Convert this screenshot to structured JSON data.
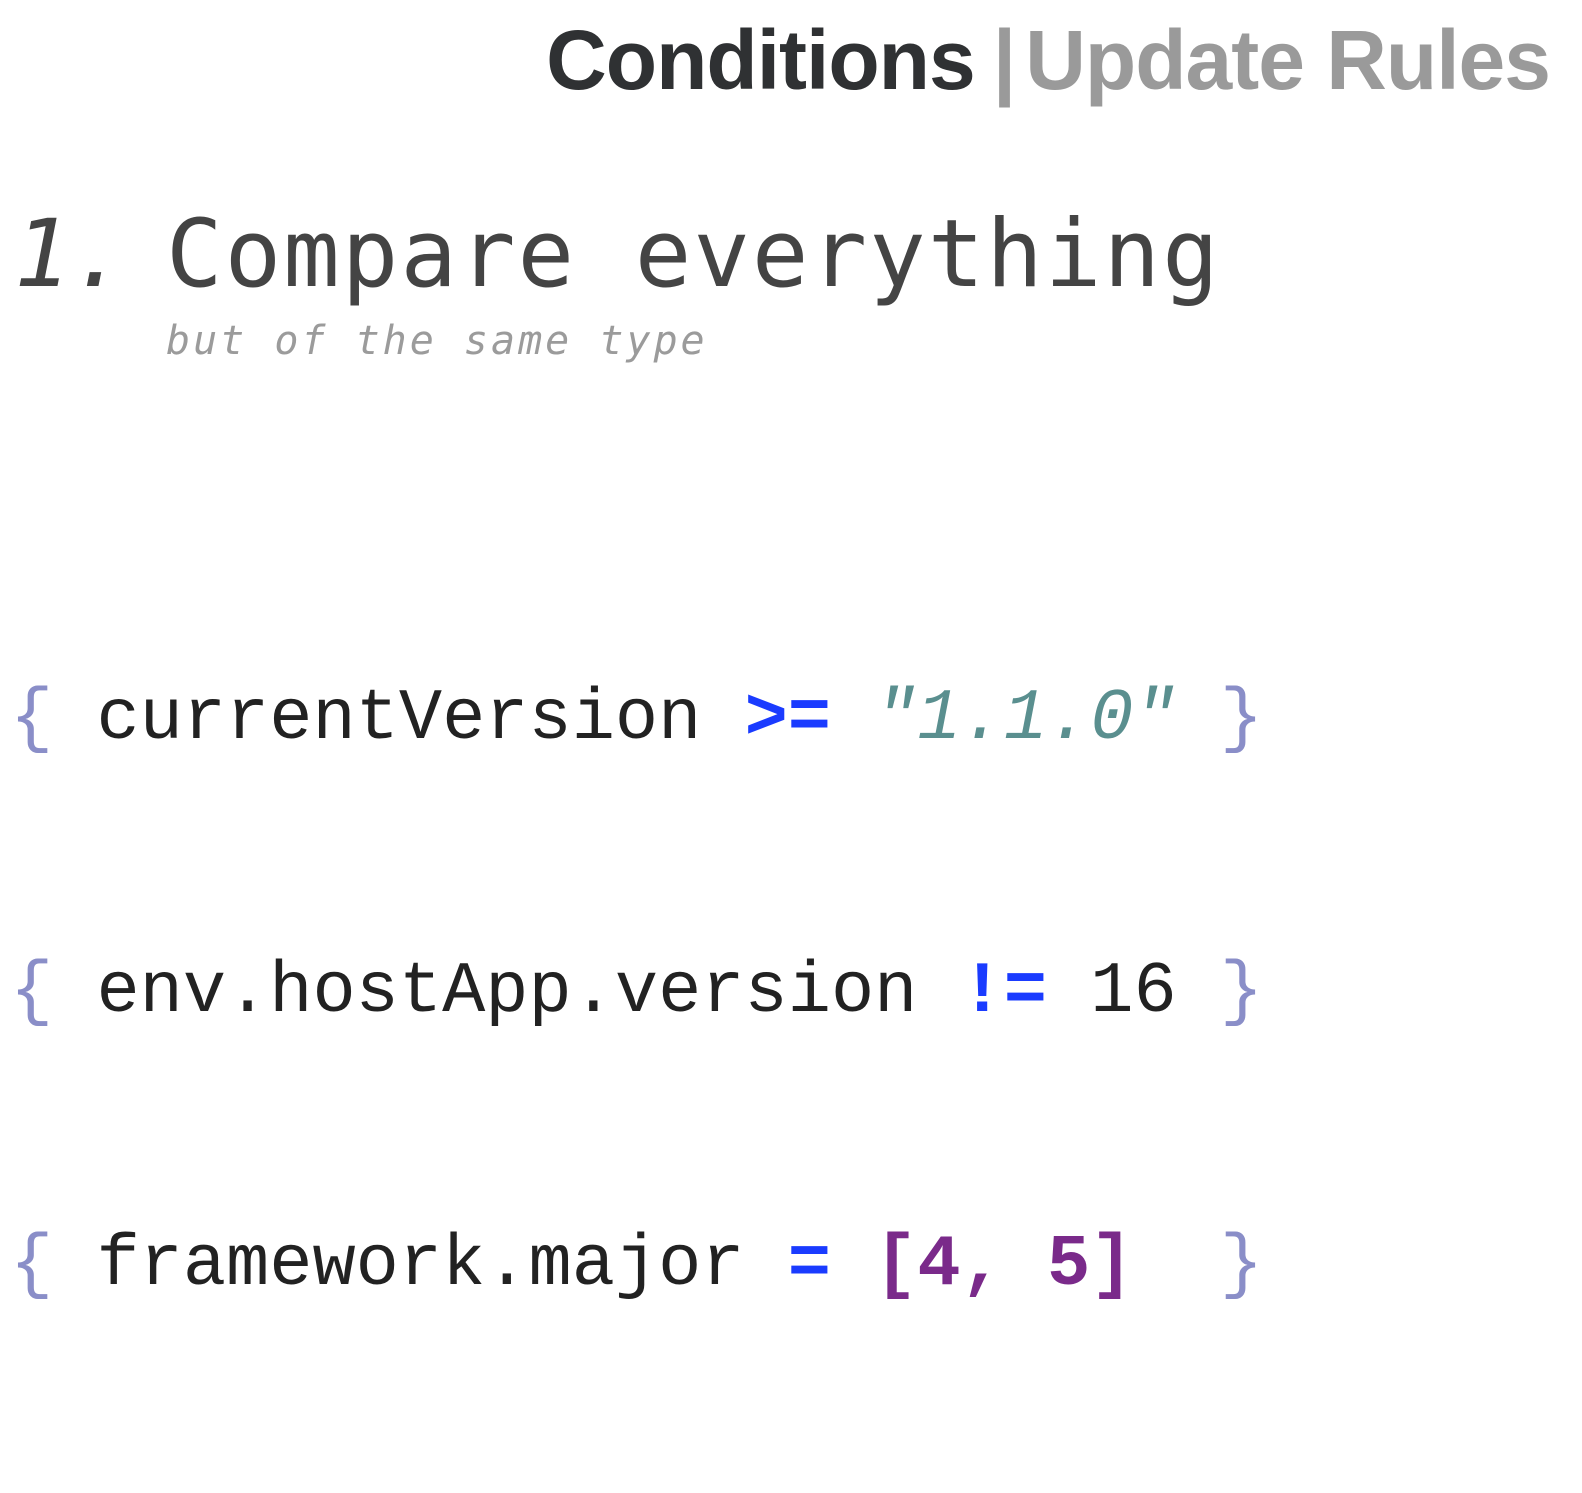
{
  "header": {
    "active_label": "Conditions",
    "separator": "|",
    "inactive_label": "Update Rules"
  },
  "section": {
    "number": "1.",
    "title": "Compare everything",
    "subtitle": "but of the same type"
  },
  "code_lines": [
    {
      "open": "{",
      "variable": "currentVersion",
      "operator": ">=",
      "value": "\"1.1.0\"",
      "value_type": "string",
      "close": "}"
    },
    {
      "open": "{",
      "variable": "env.hostApp.version",
      "operator": "!=",
      "value": "16",
      "value_type": "number",
      "close": "}"
    },
    {
      "open": "{",
      "variable": "framework.major",
      "operator": "=",
      "value": "[4, 5]",
      "value_type": "array",
      "close": "}"
    }
  ],
  "colors": {
    "header_active": "#2f3133",
    "header_inactive": "#9a9a9a",
    "brace": "#8a8ec8",
    "operator": "#1a3bff",
    "string": "#5a8f8f",
    "array": "#7a2a8a"
  }
}
